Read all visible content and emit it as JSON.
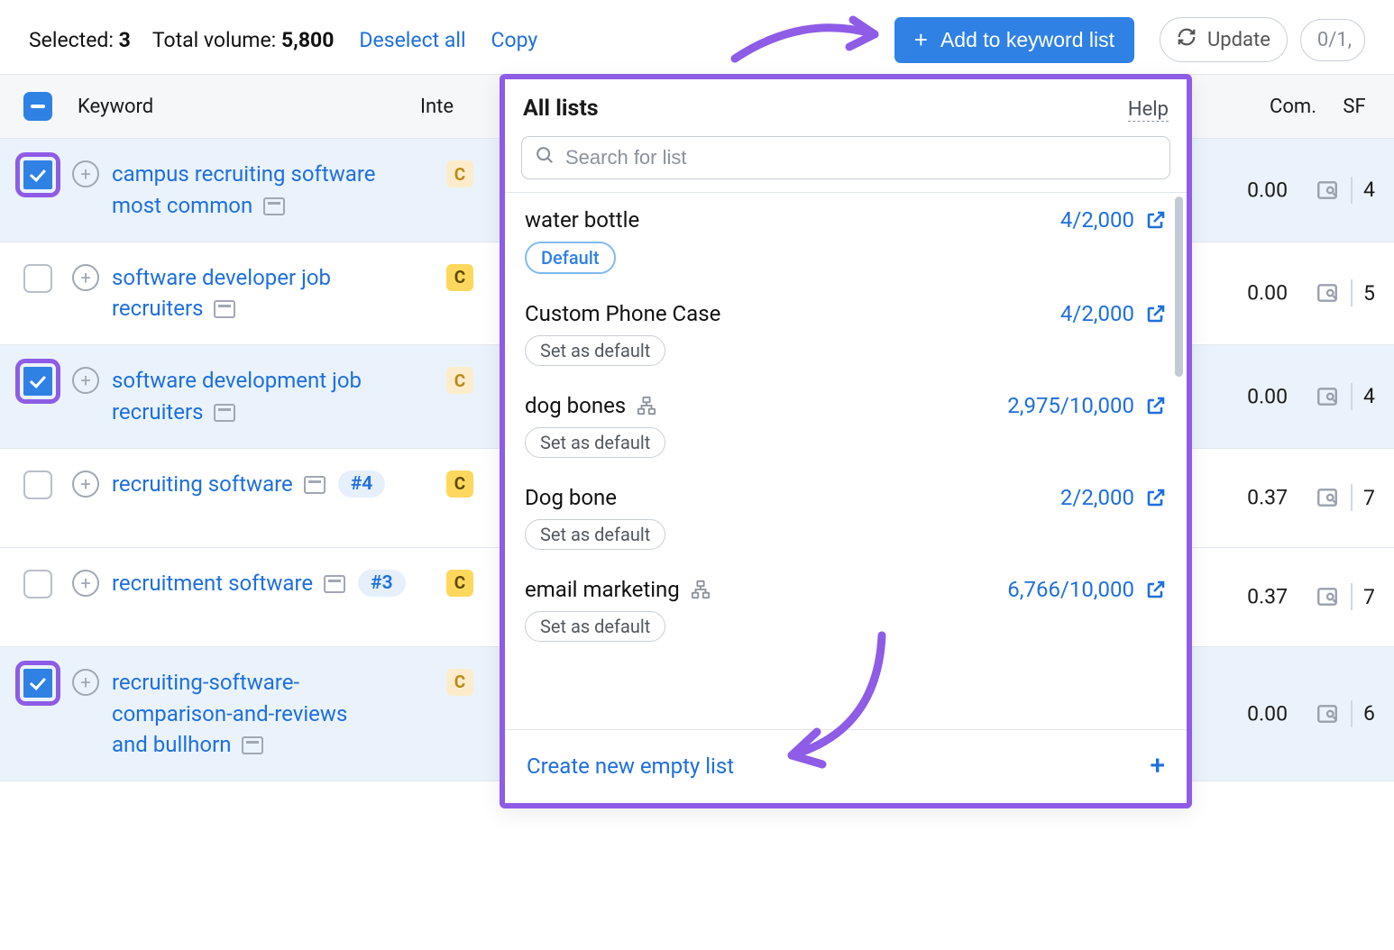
{
  "toolbar": {
    "selected_label": "Selected:",
    "selected_count": "3",
    "volume_label": "Total volume:",
    "volume_value": "5,800",
    "deselect": "Deselect all",
    "copy": "Copy",
    "add": "Add to keyword list",
    "update": "Update",
    "progress": "0/1,"
  },
  "columns": {
    "keyword": "Keyword",
    "intent": "Inte",
    "com": "Com.",
    "sf": "SF"
  },
  "rows": [
    {
      "checked": true,
      "text": "campus recruiting software most common",
      "rank": "",
      "intent": "c-faded",
      "com": "0.00",
      "sf": "4"
    },
    {
      "checked": false,
      "text": "software developer job recruiters",
      "rank": "",
      "intent": "c-bright",
      "com": "0.00",
      "sf": "5"
    },
    {
      "checked": true,
      "text": "software development job recruiters",
      "rank": "",
      "intent": "c-faded",
      "com": "0.00",
      "sf": "4"
    },
    {
      "checked": false,
      "text": "recruiting software",
      "rank": "#4",
      "intent": "c-bright",
      "com": "0.37",
      "sf": "7"
    },
    {
      "checked": false,
      "text": "recruitment software",
      "rank": "#3",
      "intent": "c-bright",
      "com": "0.37",
      "sf": "7"
    },
    {
      "checked": true,
      "text": "recruiting-software-comparison-and-reviews and bullhorn",
      "rank": "",
      "intent": "c-faded",
      "com": "0.00",
      "sf": "6"
    }
  ],
  "intent_letter": "C",
  "panel": {
    "title": "All lists",
    "help": "Help",
    "search_placeholder": "Search for list",
    "default_label": "Default",
    "set_default_label": "Set as default",
    "create": "Create new empty list",
    "items": [
      {
        "name": "water bottle",
        "shared": false,
        "count": "4/2,000",
        "is_default": true
      },
      {
        "name": "Custom Phone Case",
        "shared": false,
        "count": "4/2,000",
        "is_default": false
      },
      {
        "name": "dog bones",
        "shared": true,
        "count": "2,975/10,000",
        "is_default": false
      },
      {
        "name": "Dog bone",
        "shared": false,
        "count": "2/2,000",
        "is_default": false
      },
      {
        "name": "email marketing",
        "shared": true,
        "count": "6,766/10,000",
        "is_default": false
      }
    ]
  }
}
